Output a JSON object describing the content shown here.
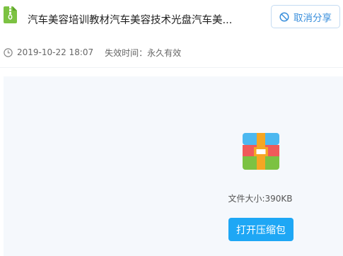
{
  "header": {
    "file_icon": "zip-file-icon",
    "title": "汽车美容培训教材汽车美容技术光盘汽车美...",
    "cancel_share_label": "取消分享",
    "cancel_icon": "ban-icon"
  },
  "meta": {
    "clock_icon": "clock-icon",
    "share_time": "2019-10-22 18:07",
    "expiry_text": "失效时间：永久有效"
  },
  "preview": {
    "archive_icon": "archive-box-icon",
    "file_size": "文件大小:390KB",
    "open_button_label": "打开压缩包"
  },
  "colors": {
    "accent": "#1ea7f5",
    "link_blue": "#3a8fdc",
    "file_icon_green": "#7cc242",
    "panel_bg": "#f5f8fc"
  }
}
